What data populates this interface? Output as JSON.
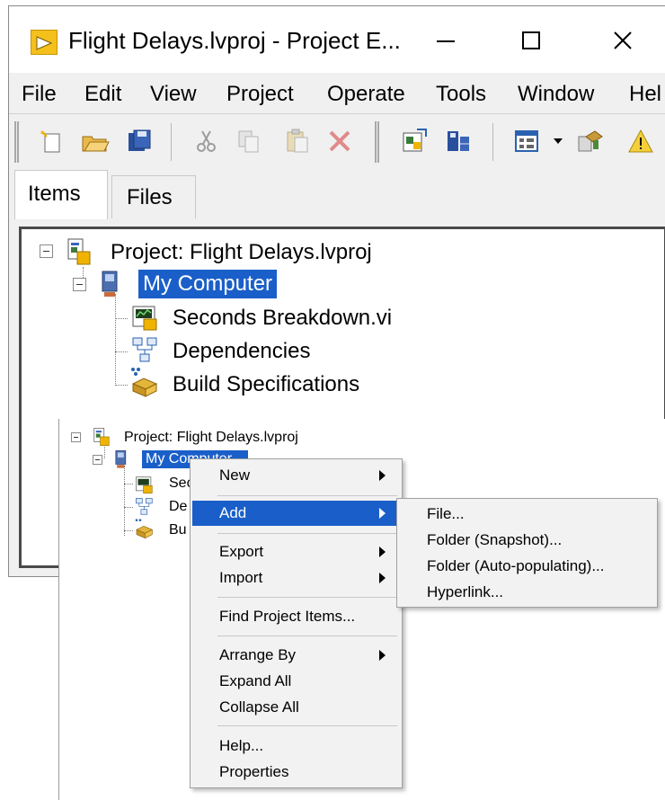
{
  "window": {
    "title": "Flight Delays.lvproj - Project E...",
    "controls": {
      "minimize": "minimize-icon",
      "maximize": "maximize-icon",
      "close": "close-icon"
    }
  },
  "menubar": {
    "items": [
      "File",
      "Edit",
      "View",
      "Project",
      "Operate",
      "Tools",
      "Window",
      "Hel"
    ]
  },
  "toolbar": {
    "buttons": [
      "new-icon",
      "open-icon",
      "save-all-icon",
      "cut-icon",
      "copy-icon",
      "paste-icon",
      "delete-icon",
      "build-icon",
      "deploy-icon",
      "view-icon",
      "dropdown-icon",
      "properties-icon",
      "warning-icon"
    ]
  },
  "tabs": [
    {
      "label": "Items",
      "active": true
    },
    {
      "label": "Files",
      "active": false
    }
  ],
  "tree": {
    "project": "Project: Flight Delays.lvproj",
    "target": "My Computer",
    "children": [
      "Seconds Breakdown.vi",
      "Dependencies",
      "Build Specifications"
    ]
  },
  "small_tree": {
    "project": "Project: Flight Delays.lvproj",
    "target": "My Computer",
    "children": [
      "Sec",
      "De",
      "Bu"
    ]
  },
  "context_menu": {
    "items": [
      {
        "label": "New",
        "submenu": true
      },
      {
        "label": "Add",
        "submenu": true,
        "highlighted": true
      },
      {
        "label": "Export",
        "submenu": true
      },
      {
        "label": "Import",
        "submenu": true
      },
      {
        "label": "Find Project Items...",
        "submenu": false
      },
      {
        "label": "Arrange By",
        "submenu": true
      },
      {
        "label": "Expand All",
        "submenu": false
      },
      {
        "label": "Collapse All",
        "submenu": false
      },
      {
        "label": "Help...",
        "submenu": false
      },
      {
        "label": "Properties",
        "submenu": false
      }
    ]
  },
  "submenu_add": {
    "items": [
      "File...",
      "Folder (Snapshot)...",
      "Folder (Auto-populating)...",
      "Hyperlink..."
    ]
  },
  "colors": {
    "selection": "#1a5fc9",
    "menu_bg": "#f2f2f2",
    "chrome_bg": "#f0f0f0",
    "app_icon": "#f3c01c"
  }
}
